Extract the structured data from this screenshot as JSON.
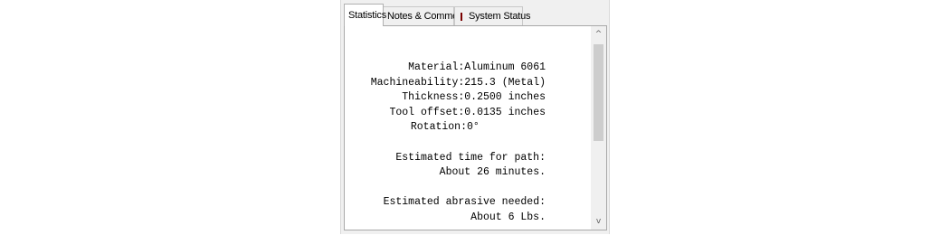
{
  "tabs": [
    {
      "label": "Statistics",
      "active": true
    },
    {
      "label": "Notes & Comments",
      "active": false
    },
    {
      "label": "System Status",
      "active": false,
      "indicator_color": "#e81b1b"
    }
  ],
  "stats": {
    "rows": [
      {
        "label": "Material:",
        "value": "Aluminum 6061"
      },
      {
        "label": "Machineability:",
        "value": "215.3 (Metal)"
      },
      {
        "label": "Thickness:",
        "value": "0.2500 inches"
      },
      {
        "label": "Tool offset:",
        "value": "0.0135 inches"
      },
      {
        "label": "Rotation:",
        "value": "0°"
      }
    ],
    "time_heading": "Estimated time for path:",
    "time_value": "About 26 minutes.",
    "abrasive_heading": "Estimated abrasive needed:",
    "abrasive_value": "About 6 Lbs."
  },
  "scrollbar": {
    "up_icon": "chevron-up-icon",
    "down_icon": "chevron-down-icon",
    "up_glyph": "^",
    "down_glyph": "v"
  }
}
